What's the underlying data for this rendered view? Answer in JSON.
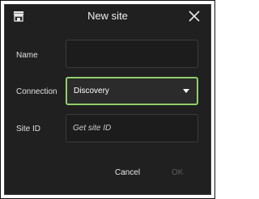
{
  "window": {
    "title": "New site",
    "icon": "store-icon",
    "close_icon": "close-icon"
  },
  "form": {
    "name": {
      "label": "Name",
      "value": ""
    },
    "connection": {
      "label": "Connection",
      "selected": "Discovery"
    },
    "site_id": {
      "label": "Site ID",
      "value": "",
      "placeholder": "Get site ID"
    }
  },
  "buttons": {
    "cancel": "Cancel",
    "ok": "OK"
  },
  "colors": {
    "dialog_bg": "#202020",
    "accent_focus": "#8fd06a",
    "disabled_text": "#5e5e5e"
  }
}
